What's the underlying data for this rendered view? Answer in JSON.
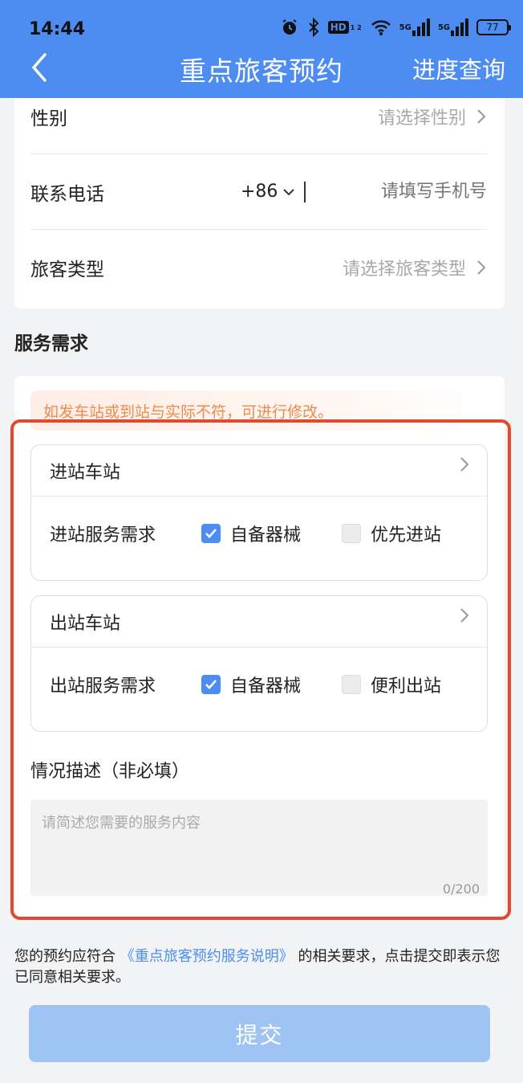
{
  "status_bar": {
    "time": "14:44",
    "hd_label": "HD",
    "hd_sub": "1 2",
    "sig1_label": "5G",
    "sig2_label": "5G",
    "battery": "77"
  },
  "nav": {
    "title": "重点旅客预约",
    "right_action": "进度查询"
  },
  "form": {
    "gender": {
      "label": "性别",
      "placeholder": "请选择性别"
    },
    "phone": {
      "label": "联系电话",
      "country_code": "+86",
      "placeholder": "请填写手机号"
    },
    "passenger_type": {
      "label": "旅客类型",
      "placeholder": "请选择旅客类型"
    }
  },
  "service": {
    "section_title": "服务需求",
    "notice": "如发车站或到站与实际不符，可进行修改。",
    "entry": {
      "station_label": "进站车站",
      "need_label": "进站服务需求",
      "option1": {
        "label": "自备器械",
        "checked": true
      },
      "option2": {
        "label": "优先进站",
        "checked": false
      }
    },
    "exit": {
      "station_label": "出站车站",
      "need_label": "出站服务需求",
      "option1": {
        "label": "自备器械",
        "checked": true
      },
      "option2": {
        "label": "便利出站",
        "checked": false
      }
    },
    "description": {
      "label": "情况描述（非必填）",
      "placeholder": "请简述您需要的服务内容",
      "counter": "0/200"
    }
  },
  "agreement": {
    "prefix": "您的预约应符合",
    "link": "《重点旅客预约服务说明》",
    "suffix": "的相关要求，点击提交即表示您已同意相关要求。"
  },
  "submit_label": "提交",
  "colors": {
    "primary": "#4d8cf0",
    "notice_text": "#ee8a4b",
    "highlight_border": "#e24a30",
    "submit_disabled": "#9fc3f2"
  }
}
